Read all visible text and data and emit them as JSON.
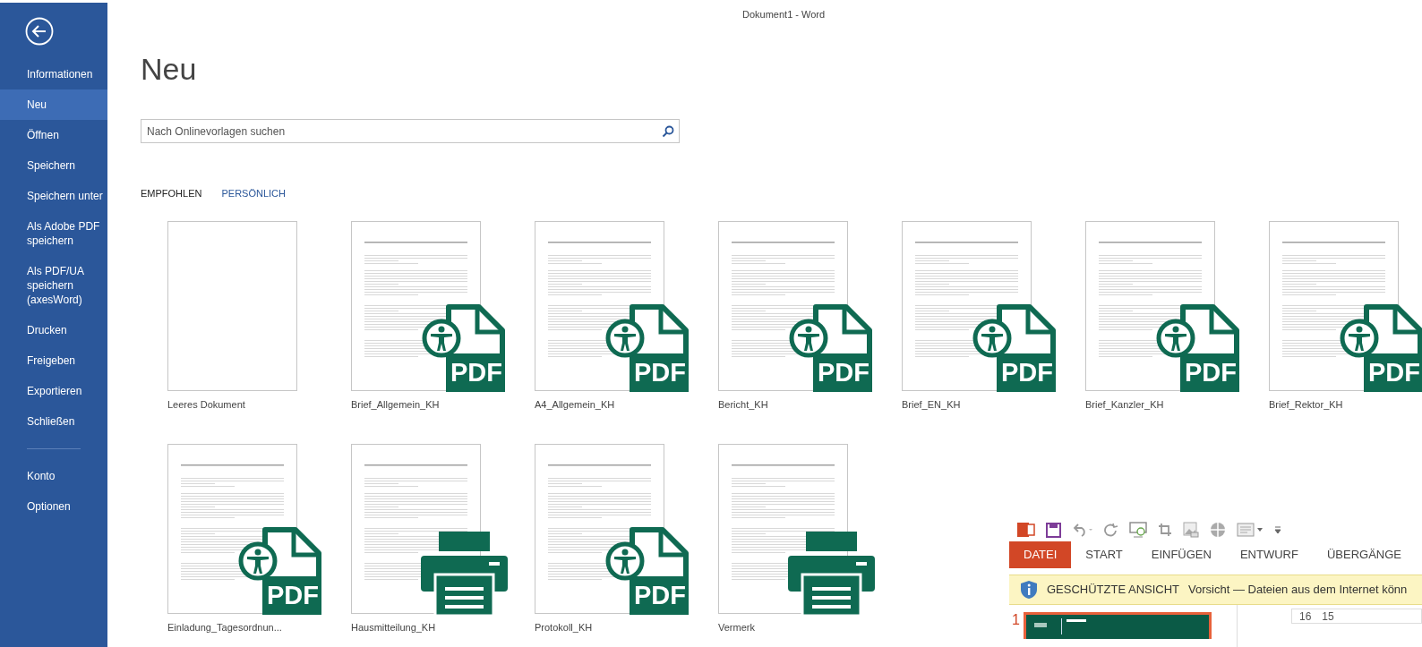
{
  "window": {
    "title": "Dokument1 - Word"
  },
  "sidebar": {
    "items": [
      {
        "label": "Informationen",
        "selected": false
      },
      {
        "label": "Neu",
        "selected": true
      },
      {
        "label": "Öffnen",
        "selected": false
      },
      {
        "label": "Speichern",
        "selected": false
      },
      {
        "label": "Speichern unter",
        "selected": false
      },
      {
        "label": "Als Adobe PDF speichern",
        "selected": false
      },
      {
        "label": "Als PDF/UA speichern (axesWord)",
        "selected": false
      },
      {
        "label": "Drucken",
        "selected": false
      },
      {
        "label": "Freigeben",
        "selected": false
      },
      {
        "label": "Exportieren",
        "selected": false
      },
      {
        "label": "Schließen",
        "selected": false
      }
    ],
    "footer_items": [
      {
        "label": "Konto",
        "selected": false
      },
      {
        "label": "Optionen",
        "selected": false
      }
    ]
  },
  "page": {
    "title": "Neu",
    "search": {
      "placeholder": "Nach Onlinevorlagen suchen"
    },
    "tabs": [
      {
        "label": "EMPFOHLEN",
        "selected": true
      },
      {
        "label": "PERSÖNLICH",
        "selected": false
      }
    ]
  },
  "templates": [
    {
      "name": "Leeres Dokument",
      "kind": "blank"
    },
    {
      "name": "Brief_Allgemein_KH",
      "kind": "pdf",
      "badge": "PDF"
    },
    {
      "name": "A4_Allgemein_KH",
      "kind": "pdf",
      "badge": "PDF"
    },
    {
      "name": "Bericht_KH",
      "kind": "pdf",
      "badge": "PDF"
    },
    {
      "name": "Brief_EN_KH",
      "kind": "pdf",
      "badge": "PDF"
    },
    {
      "name": "Brief_Kanzler_KH",
      "kind": "pdf",
      "badge": "PDF"
    },
    {
      "name": "Brief_Rektor_KH",
      "kind": "pdf",
      "badge": "PDF"
    },
    {
      "name": "Einladung_Tagesordnun...",
      "kind": "pdf",
      "badge": "PDF"
    },
    {
      "name": "Hausmitteilung_KH",
      "kind": "print"
    },
    {
      "name": "Protokoll_KH",
      "kind": "pdf",
      "badge": "PDF"
    },
    {
      "name": "Vermerk",
      "kind": "print"
    }
  ],
  "overlay_window": {
    "tabs": [
      {
        "label": "DATEI",
        "selected": true
      },
      {
        "label": "START",
        "selected": false
      },
      {
        "label": "EINFÜGEN",
        "selected": false
      },
      {
        "label": "ENTWURF",
        "selected": false
      },
      {
        "label": "ÜBERGÄNGE",
        "selected": false
      }
    ],
    "notice": {
      "title": "GESCHÜTZTE ANSICHT",
      "message": "Vorsicht — Dateien aus dem Internet könn"
    },
    "slide_number": "1",
    "ruler": [
      "16",
      "15"
    ]
  }
}
